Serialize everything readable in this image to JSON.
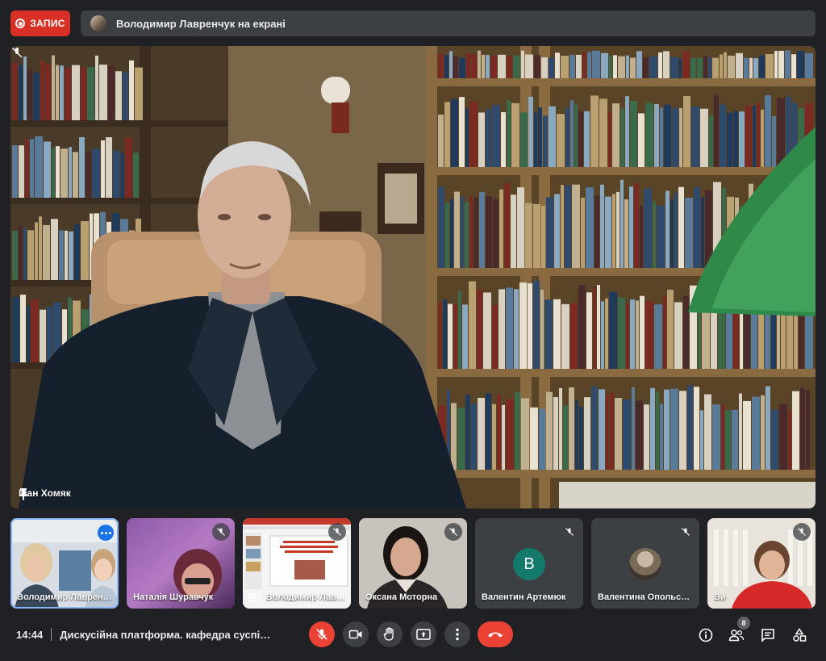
{
  "recording": {
    "label": "ЗАПИС",
    "color": "#d93025"
  },
  "presenter_banner": {
    "text": "Володимир Лавренчук на екрані"
  },
  "main_speaker": {
    "name": "Іван Хомяк",
    "pinned": true,
    "muted": true
  },
  "participants": [
    {
      "name": "Володимир Лавренчук",
      "active": true,
      "muted": false,
      "more_menu": true
    },
    {
      "name": "Наталія Шуравчук",
      "active": false,
      "muted": true
    },
    {
      "name": "Володимир Лавренчук",
      "active": false,
      "muted": true,
      "presenting": true
    },
    {
      "name": "Оксана Моторна",
      "active": false,
      "muted": true
    },
    {
      "name": "Валентин Артемюк",
      "active": false,
      "muted": true,
      "avatar_letter": "В",
      "avatar_color": "#137a6b"
    },
    {
      "name": "Валентина Опольська",
      "active": false,
      "muted": true,
      "avatar_photo": true
    },
    {
      "name": "Ви",
      "active": false,
      "muted": true
    }
  ],
  "bottom_bar": {
    "time": "14:44",
    "meeting_title": "Дискусійна платформа. кафедра суспільних",
    "participant_count": "8"
  },
  "icons": {
    "mic_off": "mic-off-icon",
    "camera": "camera-icon",
    "raise_hand": "raise-hand-icon",
    "present": "present-screen-icon",
    "more": "more-vert-icon",
    "end_call": "end-call-icon",
    "info": "info-icon",
    "people": "people-icon",
    "chat": "chat-icon",
    "activities": "activities-icon",
    "pin": "pin-icon"
  },
  "colors": {
    "accent_blue": "#8ab4f8",
    "end_red": "#ea4335",
    "bar": "#3c4043",
    "bg": "#202124"
  }
}
